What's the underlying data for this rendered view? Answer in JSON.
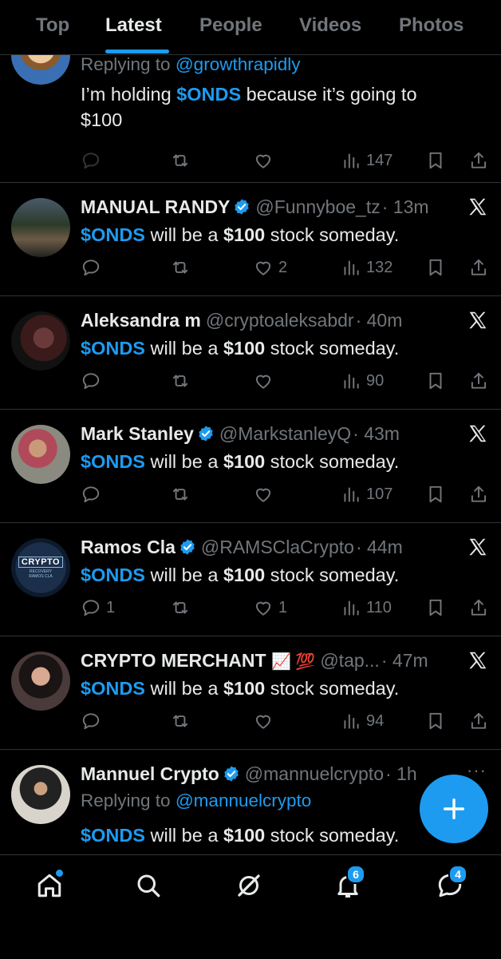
{
  "tabs": [
    "Top",
    "Latest",
    "People",
    "Videos",
    "Photos"
  ],
  "tweets": [
    {
      "reply_prefix": "Replying to",
      "reply_handle": "@growthrapidly",
      "text_before": "I’m holding ",
      "cashtag": "$ONDS",
      "text_after": " because it’s going to",
      "text_line2": "$100",
      "views": "147"
    },
    {
      "name": "MANUAL RANDY",
      "handle": "@Funnyboe_tz",
      "time": "· 13m",
      "cashtag": "$ONDS",
      "mid": " will be a ",
      "amount": "$100",
      "end": " stock someday.",
      "likes": "2",
      "views": "132"
    },
    {
      "name": "Aleksandra m",
      "handle": "@cryptoaleksabdr",
      "time": "· 40m",
      "cashtag": "$ONDS",
      "mid": " will be a ",
      "amount": "$100",
      "end": " stock someday.",
      "views": "90"
    },
    {
      "name": "Mark Stanley",
      "handle": "@MarkstanleyQ",
      "time": "· 43m",
      "cashtag": "$ONDS",
      "mid": " will be a ",
      "amount": "$100",
      "end": " stock someday.",
      "views": "107"
    },
    {
      "name": "Ramos Cla",
      "handle": "@RAMSClaCrypto",
      "time": "· 44m",
      "cashtag": "$ONDS",
      "mid": " will be a ",
      "amount": "$100",
      "end": " stock someday.",
      "replies": "1",
      "likes": "1",
      "views": "110",
      "avatar_text1": "CRYPTO",
      "avatar_text2": "RECOVERY",
      "avatar_text3": "RAMOS CLA"
    },
    {
      "name": "CRYPTO MERCHANT",
      "emojis": "📈 💯",
      "handle": "@tap...",
      "time": "· 47m",
      "cashtag": "$ONDS",
      "mid": " will be a ",
      "amount": "$100",
      "end": " stock someday.",
      "views": "94"
    },
    {
      "name": "Mannuel Crypto",
      "handle": "@mannuelcrypto",
      "time": "· 1h",
      "more": "···",
      "reply_prefix": "Replying to",
      "reply_handle": "@mannuelcrypto",
      "cashtag": "$ONDS",
      "mid": " will be a ",
      "amount": "$100",
      "end": " stock someday."
    }
  ],
  "fab_label": "+",
  "nav": {
    "notifications_badge": "6",
    "messages_badge": "4"
  },
  "colors": {
    "accent": "#1d9bf0",
    "background": "#000000",
    "text": "#e7e9ea",
    "muted": "#71767b",
    "divider": "#2f3336"
  }
}
